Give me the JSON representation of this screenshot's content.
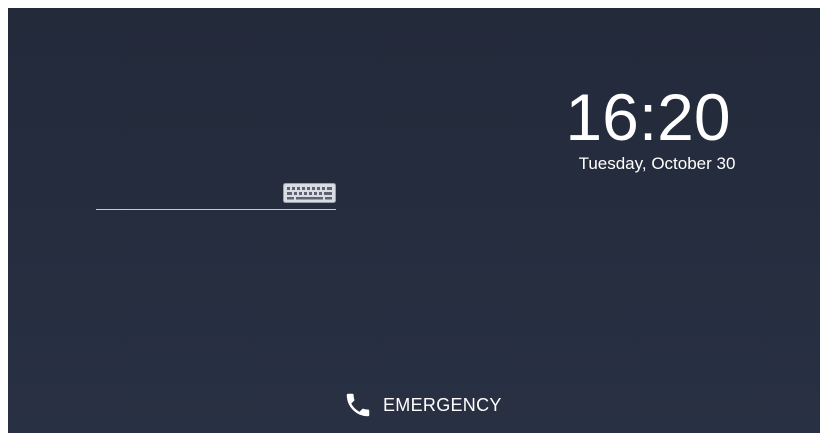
{
  "lockscreen": {
    "time": "16:20",
    "date": "Tuesday, October 30",
    "password": {
      "value": "",
      "placeholder": ""
    },
    "keyboard_icon": "keyboard-icon",
    "emergency_label": "EMERGENCY",
    "emergency_icon": "phone-icon"
  },
  "colors": {
    "background": "#262d3f",
    "text": "#ffffff",
    "input_underline": "#c8ccd6"
  }
}
